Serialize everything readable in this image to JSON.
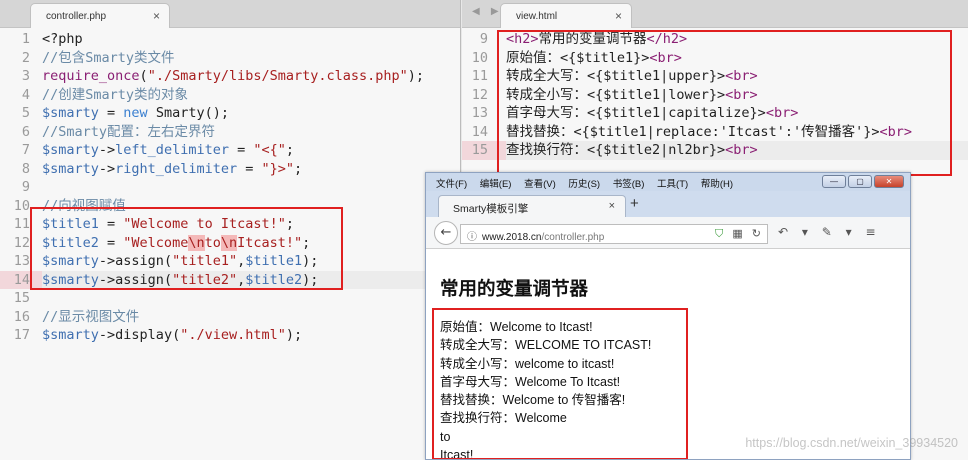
{
  "editor_left": {
    "tab_label": "controller.php",
    "close_glyph": "×",
    "lines": [
      {
        "n": "1",
        "tokens": [
          {
            "t": "<?php",
            "c": "plain"
          }
        ]
      },
      {
        "n": "2",
        "tokens": [
          {
            "t": "//包含Smarty类文件",
            "c": "comment"
          }
        ]
      },
      {
        "n": "3",
        "tokens": [
          {
            "t": "require_once",
            "c": "fn"
          },
          {
            "t": "(",
            "c": "plain"
          },
          {
            "t": "\"./Smarty/libs/Smarty.class.php\"",
            "c": "str"
          },
          {
            "t": ");",
            "c": "plain"
          }
        ]
      },
      {
        "n": "4",
        "tokens": [
          {
            "t": "//创建Smarty类的对象",
            "c": "comment"
          }
        ]
      },
      {
        "n": "5",
        "tokens": [
          {
            "t": "$smarty",
            "c": "var"
          },
          {
            "t": " = ",
            "c": "plain"
          },
          {
            "t": "new",
            "c": "kw"
          },
          {
            "t": " Smarty();",
            "c": "plain"
          }
        ]
      },
      {
        "n": "6",
        "tokens": [
          {
            "t": "//Smarty配置：左右定界符",
            "c": "comment"
          }
        ]
      },
      {
        "n": "7",
        "tokens": [
          {
            "t": "$smarty",
            "c": "var"
          },
          {
            "t": "->",
            "c": "plain"
          },
          {
            "t": "left_delimiter",
            "c": "var"
          },
          {
            "t": " = ",
            "c": "plain"
          },
          {
            "t": "\"<{\"",
            "c": "str"
          },
          {
            "t": ";",
            "c": "plain"
          }
        ]
      },
      {
        "n": "8",
        "tokens": [
          {
            "t": "$smarty",
            "c": "var"
          },
          {
            "t": "->",
            "c": "plain"
          },
          {
            "t": "right_delimiter",
            "c": "var"
          },
          {
            "t": " = ",
            "c": "plain"
          },
          {
            "t": "\"}>\"",
            "c": "str"
          },
          {
            "t": ";",
            "c": "plain"
          }
        ]
      },
      {
        "n": "9",
        "tokens": []
      },
      {
        "n": "10",
        "tokens": [
          {
            "t": "//向视图赋值",
            "c": "comment"
          }
        ]
      },
      {
        "n": "11",
        "tokens": [
          {
            "t": "$title1",
            "c": "var"
          },
          {
            "t": " = ",
            "c": "plain"
          },
          {
            "t": "\"Welcome to Itcast!\"",
            "c": "str"
          },
          {
            "t": ";",
            "c": "plain"
          }
        ]
      },
      {
        "n": "12",
        "tokens": [
          {
            "t": "$title2",
            "c": "var"
          },
          {
            "t": " = ",
            "c": "plain"
          },
          {
            "t": "\"Welcome",
            "c": "str"
          },
          {
            "t": "\\n",
            "c": "esc"
          },
          {
            "t": "to",
            "c": "str"
          },
          {
            "t": "\\n",
            "c": "esc"
          },
          {
            "t": "Itcast!\"",
            "c": "str"
          },
          {
            "t": ";",
            "c": "plain"
          }
        ]
      },
      {
        "n": "13",
        "tokens": [
          {
            "t": "$smarty",
            "c": "var"
          },
          {
            "t": "->",
            "c": "plain"
          },
          {
            "t": "assign(",
            "c": "plain"
          },
          {
            "t": "\"title1\"",
            "c": "str"
          },
          {
            "t": ",",
            "c": "plain"
          },
          {
            "t": "$title1",
            "c": "var"
          },
          {
            "t": ");",
            "c": "plain"
          }
        ]
      },
      {
        "n": "14",
        "hl": true,
        "tokens": [
          {
            "t": "$smarty",
            "c": "var"
          },
          {
            "t": "->",
            "c": "plain"
          },
          {
            "t": "assign(",
            "c": "plain"
          },
          {
            "t": "\"title2\"",
            "c": "str"
          },
          {
            "t": ",",
            "c": "plain"
          },
          {
            "t": "$title2",
            "c": "var"
          },
          {
            "t": ");",
            "c": "plain"
          }
        ]
      },
      {
        "n": "15",
        "tokens": []
      },
      {
        "n": "16",
        "tokens": [
          {
            "t": "//显示视图文件",
            "c": "comment"
          }
        ]
      },
      {
        "n": "17",
        "tokens": [
          {
            "t": "$smarty",
            "c": "var"
          },
          {
            "t": "->",
            "c": "plain"
          },
          {
            "t": "display(",
            "c": "plain"
          },
          {
            "t": "\"./view.html\"",
            "c": "str"
          },
          {
            "t": ");",
            "c": "plain"
          }
        ]
      }
    ]
  },
  "editor_right": {
    "tab_label": "view.html",
    "close_glyph": "×",
    "nav_arrows": "◀ ▶",
    "lines": [
      {
        "n": "9",
        "tokens": [
          {
            "t": "<h2>",
            "c": "tag"
          },
          {
            "t": "常用的变量调节器",
            "c": "plain"
          },
          {
            "t": "</h2>",
            "c": "tag"
          }
        ]
      },
      {
        "n": "10",
        "tokens": [
          {
            "t": "原始值：<{$title1}>",
            "c": "plain"
          },
          {
            "t": "<br>",
            "c": "tag"
          }
        ]
      },
      {
        "n": "11",
        "tokens": [
          {
            "t": "转成全大写：<{$title1|upper}>",
            "c": "plain"
          },
          {
            "t": "<br>",
            "c": "tag"
          }
        ]
      },
      {
        "n": "12",
        "tokens": [
          {
            "t": "转成全小写：<{$title1|lower}>",
            "c": "plain"
          },
          {
            "t": "<br>",
            "c": "tag"
          }
        ]
      },
      {
        "n": "13",
        "tokens": [
          {
            "t": "首字母大写：<{$title1|capitalize}>",
            "c": "plain"
          },
          {
            "t": "<br>",
            "c": "tag"
          }
        ]
      },
      {
        "n": "14",
        "tokens": [
          {
            "t": "替找替换：<{$title1|replace:'Itcast':'传智播客'}>",
            "c": "plain"
          },
          {
            "t": "<br>",
            "c": "tag"
          }
        ]
      },
      {
        "n": "15",
        "hl": true,
        "tokens": [
          {
            "t": "查找换行符：<{$title2|nl2br}>",
            "c": "plain"
          },
          {
            "t": "<br>",
            "c": "tag"
          }
        ]
      }
    ]
  },
  "browser": {
    "menu": [
      "文件(F)",
      "编辑(E)",
      "查看(V)",
      "历史(S)",
      "书签(B)",
      "工具(T)",
      "帮助(H)"
    ],
    "window_buttons": {
      "minimize": "—",
      "maximize": "▢",
      "close": "✕"
    },
    "tab_title": "Smarty模板引擎",
    "tab_close": "×",
    "new_tab": "+",
    "back_glyph": "←",
    "url_info_glyph": "ⓘ",
    "url_domain": "www.2018.cn",
    "url_path": "/controller.php",
    "url_icons": {
      "shield": "⛉",
      "qr": "▦",
      "reload": "↻"
    },
    "nav_icons": [
      "↶",
      "▾",
      "✎",
      "▾",
      "≡"
    ],
    "page_title": "常用的变量调节器",
    "output_lines": [
      "原始值：Welcome to Itcast!",
      "转成全大写：WELCOME TO ITCAST!",
      "转成全小写：welcome to itcast!",
      "首字母大写：Welcome To Itcast!",
      "替找替换：Welcome to 传智播客!",
      "查找换行符：Welcome",
      "to",
      "Itcast!"
    ]
  },
  "watermark": "https://blog.csdn.net/weixin_39934520",
  "colors": {
    "highlight_box": "#e02020",
    "comment": "#6a8aa6",
    "variable": "#3f6fb0",
    "string": "#a72020",
    "tag": "#8a1f73"
  }
}
